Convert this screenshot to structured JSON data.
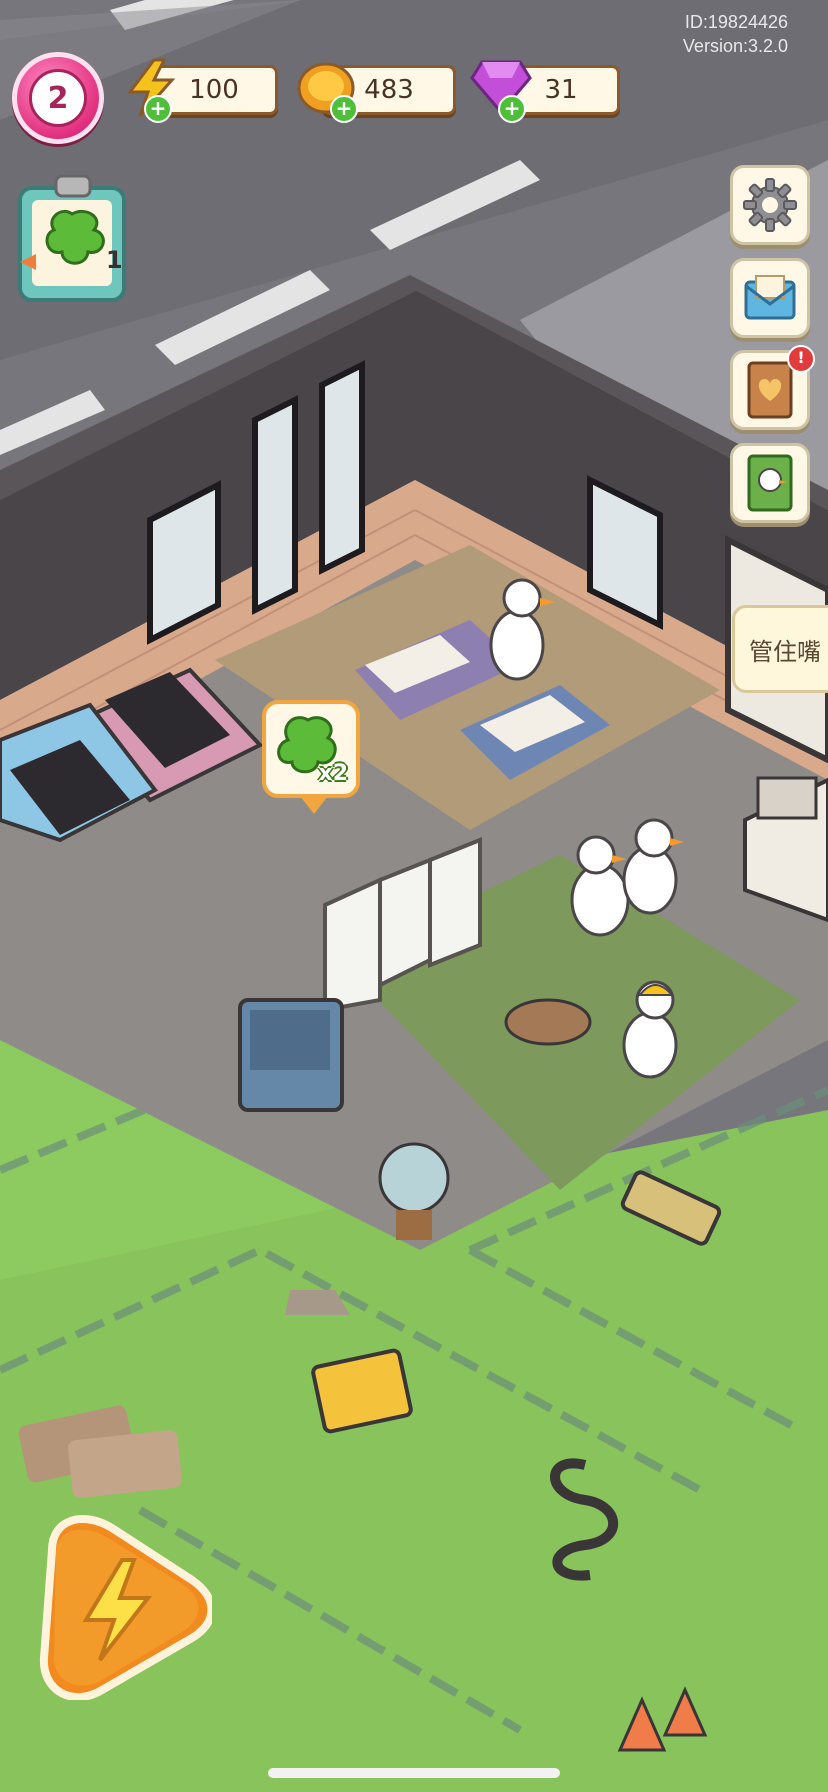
{
  "player": {
    "level": "2"
  },
  "resources": {
    "energy": {
      "value": "100",
      "icon": "lightning-icon",
      "color": "#f6c21c"
    },
    "coins": {
      "value": "483",
      "icon": "coin-icon",
      "color": "#f0a020"
    },
    "gems": {
      "value": "31",
      "icon": "gem-icon",
      "color": "#c34fd8"
    }
  },
  "build_info": {
    "id": "ID:19824426",
    "version": "Version:3.2.0"
  },
  "quest_board": {
    "count": "1",
    "icon": "clipboard-leaf-icon"
  },
  "side_menu": [
    {
      "name": "settings",
      "icon": "gear-icon"
    },
    {
      "name": "mail",
      "icon": "envelope-icon"
    },
    {
      "name": "journal",
      "icon": "heart-book-icon",
      "alert": "!"
    },
    {
      "name": "collection",
      "icon": "duck-book-icon"
    }
  ],
  "tooltip": {
    "text": "管住嘴"
  },
  "reward_bubble": {
    "count": "x2",
    "icon": "green-leaf-icon"
  },
  "action_button": {
    "icon": "lightning-icon"
  },
  "colors": {
    "accent_pink": "#e2307e",
    "grass": "#86c45a",
    "road": "#6e6e74",
    "wall": "#4a4548"
  }
}
